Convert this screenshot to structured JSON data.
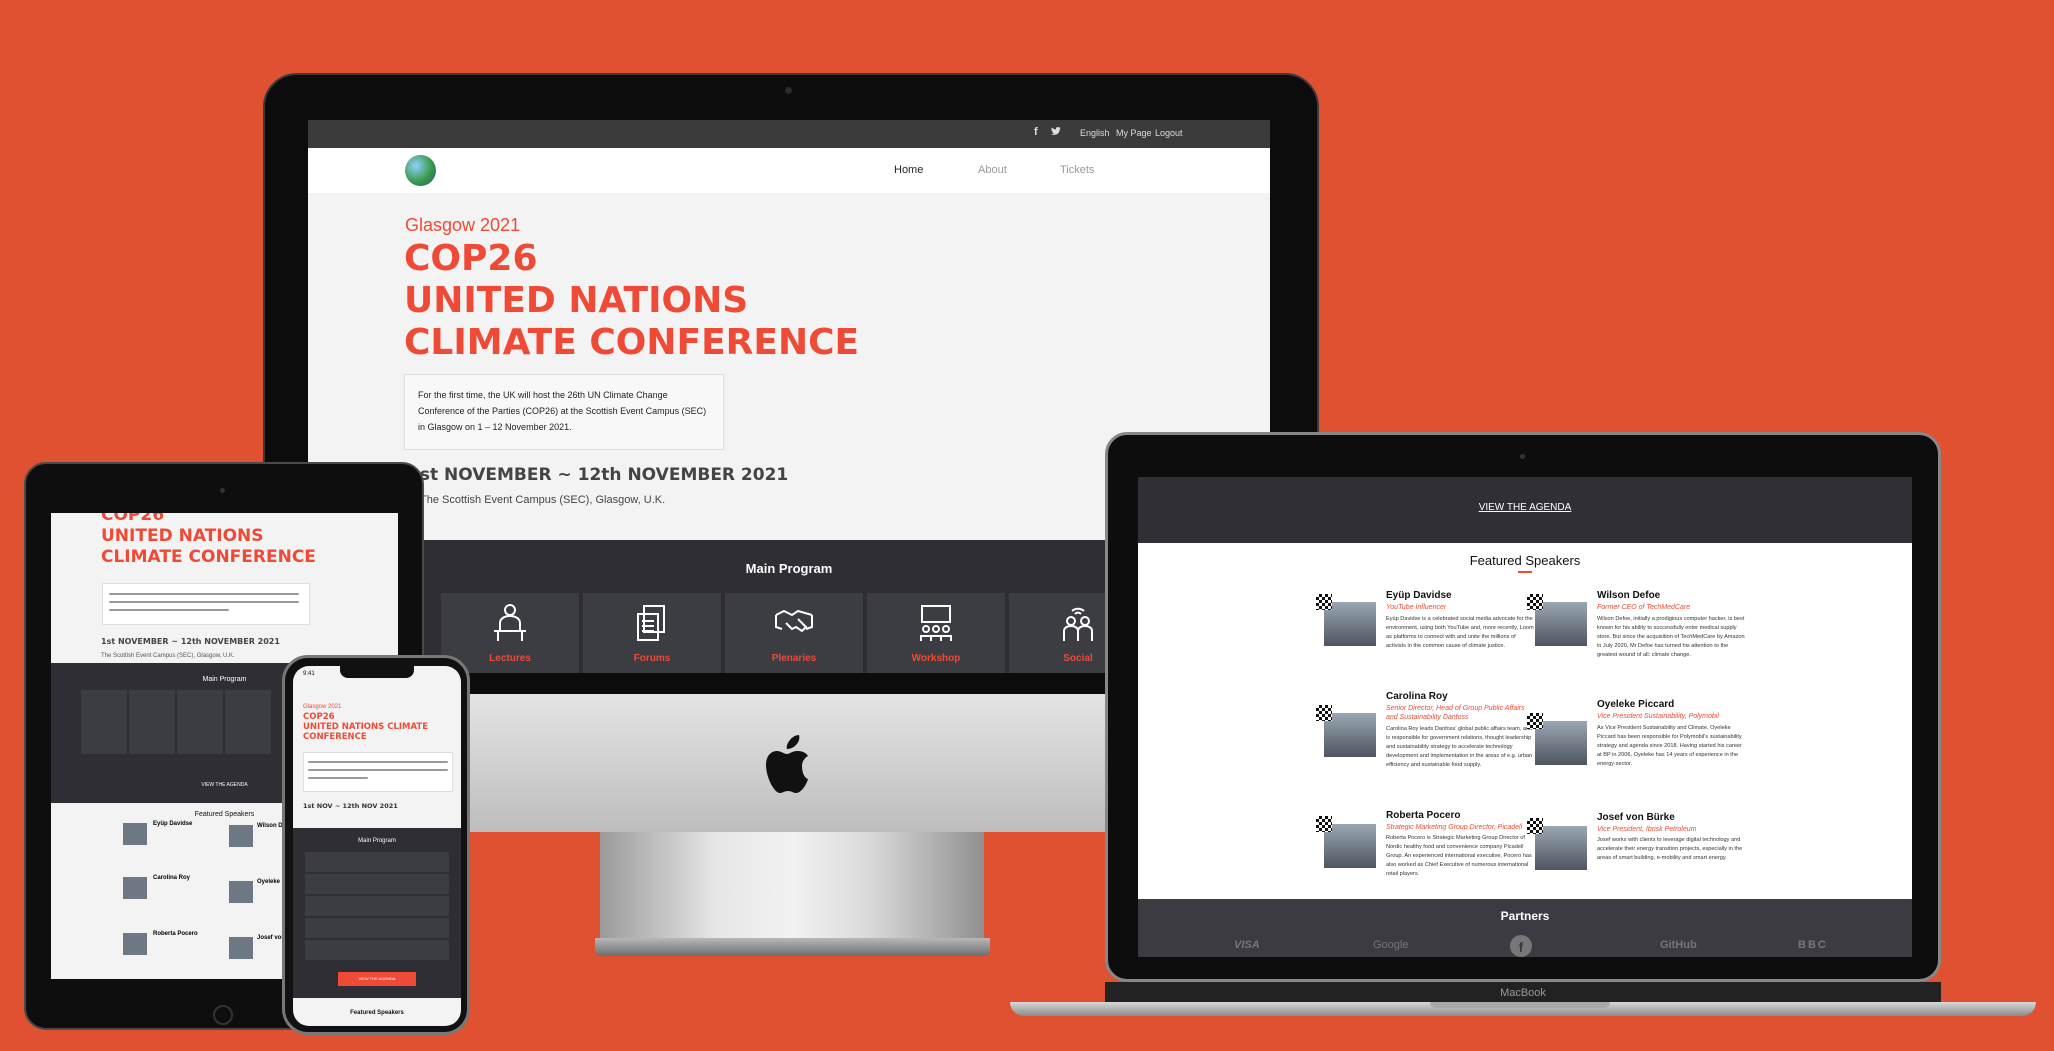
{
  "desktop": {
    "topbar": {
      "lang": "English",
      "mypage": "My Page",
      "logout": "Logout"
    },
    "nav": {
      "home": "Home",
      "about": "About",
      "tickets": "Tickets"
    },
    "hero": {
      "eyebrow": "Glasgow 2021",
      "title_lines": [
        "COP26",
        "UNITED NATIONS",
        "CLIMATE CONFERENCE"
      ],
      "description": "For the first time, the UK will host the 26th UN Climate Change Conference of the Parties (COP26) at the Scottish Event Campus (SEC) in Glasgow on 1 – 12 November 2021.",
      "dates": "1st NOVEMBER ~ 12th NOVEMBER 2021",
      "venue": "The Scottish Event Campus (SEC), Glasgow, U.K."
    },
    "program": {
      "title": "Main Program",
      "items": [
        {
          "label": "Lectures",
          "icon": "lecture-icon"
        },
        {
          "label": "Forums",
          "icon": "forum-icon"
        },
        {
          "label": "Plenaries",
          "icon": "handshake-icon"
        },
        {
          "label": "Workshop",
          "icon": "workshop-icon"
        },
        {
          "label": "Social",
          "icon": "social-icon"
        }
      ]
    }
  },
  "tablet": {
    "title_lines": [
      "COP26",
      "UNITED NATIONS",
      "CLIMATE CONFERENCE"
    ],
    "dates": "1st NOVEMBER ~ 12th NOVEMBER 2021",
    "venue": "The Scottish Event Campus (SEC), Glasgow, U.K.",
    "program_title": "Main Program",
    "agenda": "VIEW THE AGENDA",
    "featured": "Featured Speakers",
    "speakers": [
      "Eyüp Davidse",
      "Carolina Roy",
      "Roberta Pocero"
    ],
    "speakers_right": [
      "Wilson Defoe",
      "Oyeleke Piccard",
      "Josef von Bürke"
    ]
  },
  "phone": {
    "time": "9:41",
    "eyebrow": "Glasgow 2021",
    "title_lines": [
      "COP26",
      "UNITED NATIONS CLIMATE",
      "CONFERENCE"
    ],
    "dates": "1st NOV ~ 12th NOV 2021",
    "program_title": "Main Program",
    "cta": "VIEW THE AGENDA",
    "featured": "Featured Speakers"
  },
  "laptop": {
    "agenda": "VIEW THE AGENDA",
    "featured": "Featured Speakers",
    "speakers": [
      {
        "name": "Eyüp Davidse",
        "role": "YouTube Influencer",
        "bio": "Eyüp Davidse is a celebrated social media advocate for the environment, using both YouTube and, more recently, Loom as platforms to connect with and unite the millions of activists in the common cause of climate justice."
      },
      {
        "name": "Wilson Defoe",
        "role": "Former CEO of TechMedCare",
        "bio": "Wilson Defoe, initially a prodigious computer hacker, is best known for his ability to successfully enter medical supply store. But since the acquisition of TechMedCare by Amazon in July 2020, Mr Defoe has turned his attention to the greatest wound of all: climate change."
      },
      {
        "name": "Carolina Roy",
        "role": "Senior Director, Head of Group Public Affairs and Sustainability Danfoss",
        "bio": "Carolina Roy leads Danfoss' global public affairs team, and is responsible for government relations, thought leadership and sustainability strategy to accelerate technology development and implementation in the areas of e.g. urban efficiency and sustainable food supply."
      },
      {
        "name": "Oyeleke Piccard",
        "role": "Vice President Sustainability, Polymobil",
        "bio": "As Vice President Sustainability and Climate, Oyeleke Piccard has been responsible for Polymobil's sustainability strategy and agenda since 2018. Having started his career at BP in 2006, Oyeleke has 14 years of experience in the energy sector."
      },
      {
        "name": "Roberta Pocero",
        "role": "Strategic Marketing Group Director, Picadell",
        "bio": "Roberta Pocero is Strategic Marketing Group Director of Nordic healthy food and convenience company Picadell Group. An experienced international executive, Pocero has also worked as Chief Executive of numerous international retail players."
      },
      {
        "name": "Josef von Bürke",
        "role": "Vice President, Ibrisk Petroleum",
        "bio": "Josef works with clients to leverage digital technology and accelerate their energy transition projects, especially in the areas of smart building, e-mobility and smart energy."
      }
    ],
    "partners_title": "Partners",
    "partners": [
      "VISA",
      "Google",
      "f",
      "GitHub",
      "BBC"
    ],
    "brand": "MacBook"
  },
  "colors": {
    "background": "#df5130",
    "accent": "#ef4a36",
    "dark": "#2e2e34"
  }
}
